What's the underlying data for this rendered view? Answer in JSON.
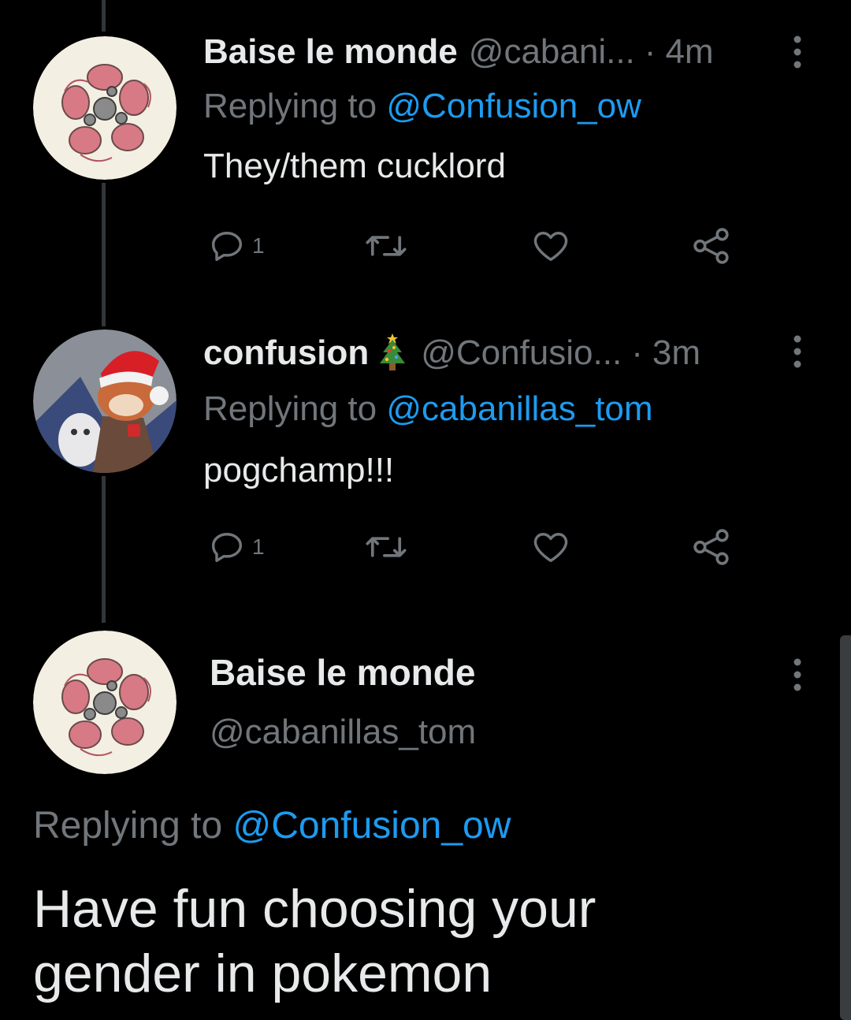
{
  "tweets": [
    {
      "name": "Baise le monde",
      "handle": "@cabani...",
      "separator": "·",
      "time": "4m",
      "replying_prefix": "Replying to",
      "replying_to": "@Confusion_ow",
      "text": "They/them cucklord",
      "reply_count": "1",
      "avatar_icon": "floral-pattern-avatar"
    },
    {
      "name": "confusion",
      "name_emoji": "christmas-tree-emoji",
      "handle": "@Confusio...",
      "separator": "·",
      "time": "3m",
      "replying_prefix": "Replying to",
      "replying_to": "@cabanillas_tom",
      "text": "pogchamp!!!",
      "reply_count": "1",
      "avatar_icon": "santa-hat-character-avatar"
    }
  ],
  "main_tweet": {
    "name": "Baise le monde",
    "handle": "@cabanillas_tom",
    "replying_prefix": "Replying to",
    "replying_to": "@Confusion_ow",
    "text_line1": "Have fun choosing your",
    "text_line2": "gender in pokemon",
    "avatar_icon": "floral-pattern-avatar"
  },
  "colors": {
    "background": "#000000",
    "text_primary": "#e7e9ea",
    "text_secondary": "#71767b",
    "link": "#1d9bf0",
    "thread_line": "#333639"
  }
}
